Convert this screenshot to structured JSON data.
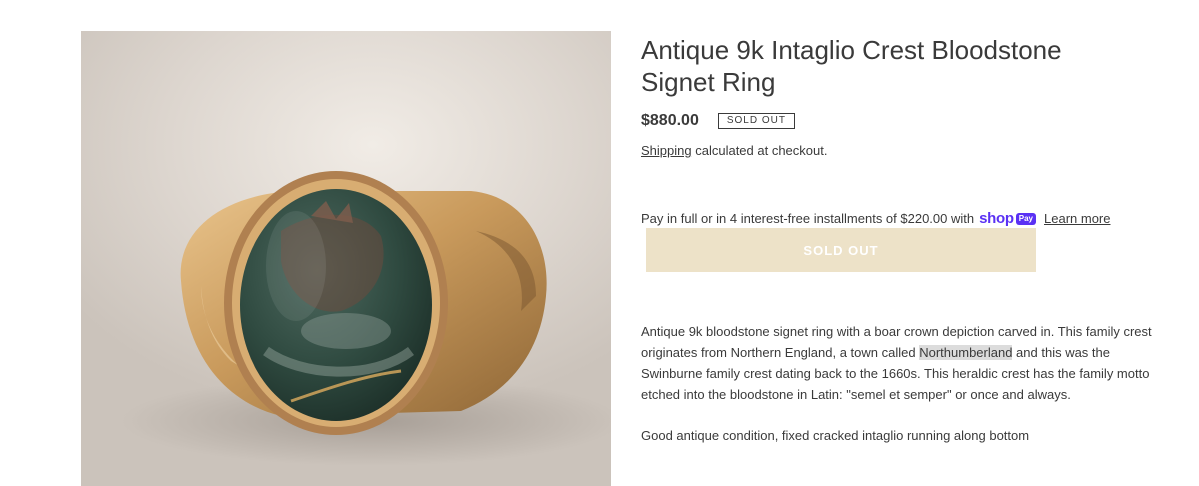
{
  "product": {
    "title": "Antique 9k Intaglio Crest Bloodstone Signet Ring",
    "price": "$880.00",
    "badge": "SOLD OUT",
    "shipping_link": "Shipping",
    "shipping_rest": " calculated at checkout.",
    "installments_text": "Pay in full or in 4 interest-free installments of $220.00 with",
    "shop_word": "shop",
    "pay_word": "Pay",
    "learn_more": "Learn more",
    "button_label": "SOLD OUT",
    "desc_part1": "Antique 9k bloodstone signet ring with a boar crown depiction carved in. This family crest originates from Northern England, a town called ",
    "desc_highlight": "Northumberland",
    "desc_part2": " and this was the Swinburne family crest dating back to the 1660s. This heraldic crest has the family motto etched into the bloodstone in Latin: \"semel et semper\" or once and always.",
    "desc_paragraph2": "Good antique condition, fixed cracked intaglio running along bottom"
  },
  "colors": {
    "button_bg": "#ede2c8",
    "shop_purple": "#5a31f4",
    "text": "#3a3a3a"
  }
}
